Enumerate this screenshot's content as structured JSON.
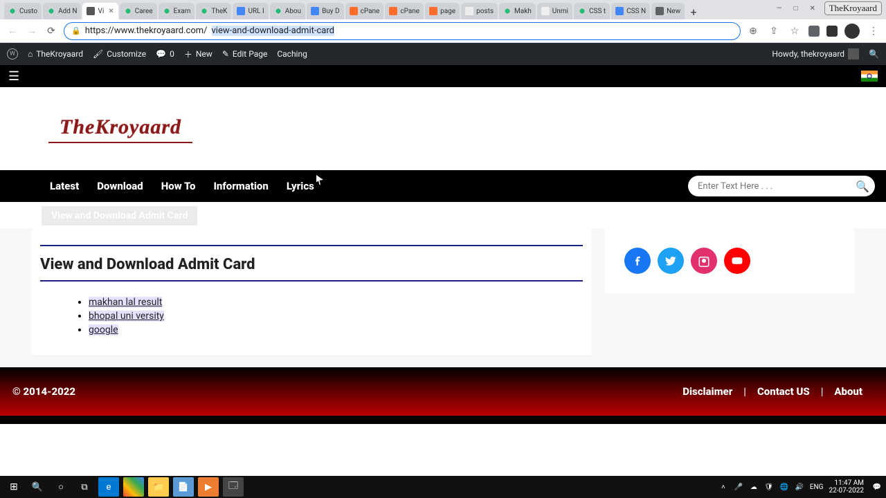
{
  "tabs": [
    {
      "label": "Custo",
      "fav": "gear"
    },
    {
      "label": "Add N",
      "fav": "gear"
    },
    {
      "label": "Vi",
      "fav": "dl",
      "active": true
    },
    {
      "label": "Caree",
      "fav": "gear"
    },
    {
      "label": "Exam",
      "fav": "gear"
    },
    {
      "label": "TheK",
      "fav": "gear"
    },
    {
      "label": "URL I",
      "fav": "grid"
    },
    {
      "label": "Abou",
      "fav": "gear"
    },
    {
      "label": "Buy D",
      "fav": "grid"
    },
    {
      "label": "cPane",
      "fav": "cpanel"
    },
    {
      "label": "cPane",
      "fav": "cpanel"
    },
    {
      "label": "page",
      "fav": "cpanel"
    },
    {
      "label": "posts",
      "fav": "w"
    },
    {
      "label": "Makh",
      "fav": "gear"
    },
    {
      "label": "Unmi",
      "fav": "w"
    },
    {
      "label": "CSS t",
      "fav": "gear"
    },
    {
      "label": "CSS N",
      "fav": "grid"
    },
    {
      "label": "New",
      "fav": ""
    }
  ],
  "new_tab": "+",
  "logo_small": "TheKroyaard",
  "url": {
    "prefix": "https://www.thekroyaard.com/",
    "selected": "view-and-download-admit-card"
  },
  "wpbar": {
    "site": "TheKroyaard",
    "customize": "Customize",
    "comments": "0",
    "new": "New",
    "edit": "Edit Page",
    "caching": "Caching",
    "howdy": "Howdy, thekroyaard"
  },
  "site_logo": "TheKroyaard",
  "nav": [
    "Latest",
    "Download",
    "How To",
    "Information",
    "Lyrics"
  ],
  "search_placeholder": "Enter Text Here . . .",
  "ghost_title": "View and Download Admit Card",
  "page_title": "View and Download Admit Card",
  "links": [
    "makhan lal result",
    "bhopal uni versity",
    "google"
  ],
  "footer": {
    "copy": "© 2014-2022",
    "links": [
      "Disclaimer",
      "Contact US",
      "About"
    ]
  },
  "tray": {
    "lang": "ENG",
    "time": "11:47 AM",
    "date": "22-07-2022"
  }
}
